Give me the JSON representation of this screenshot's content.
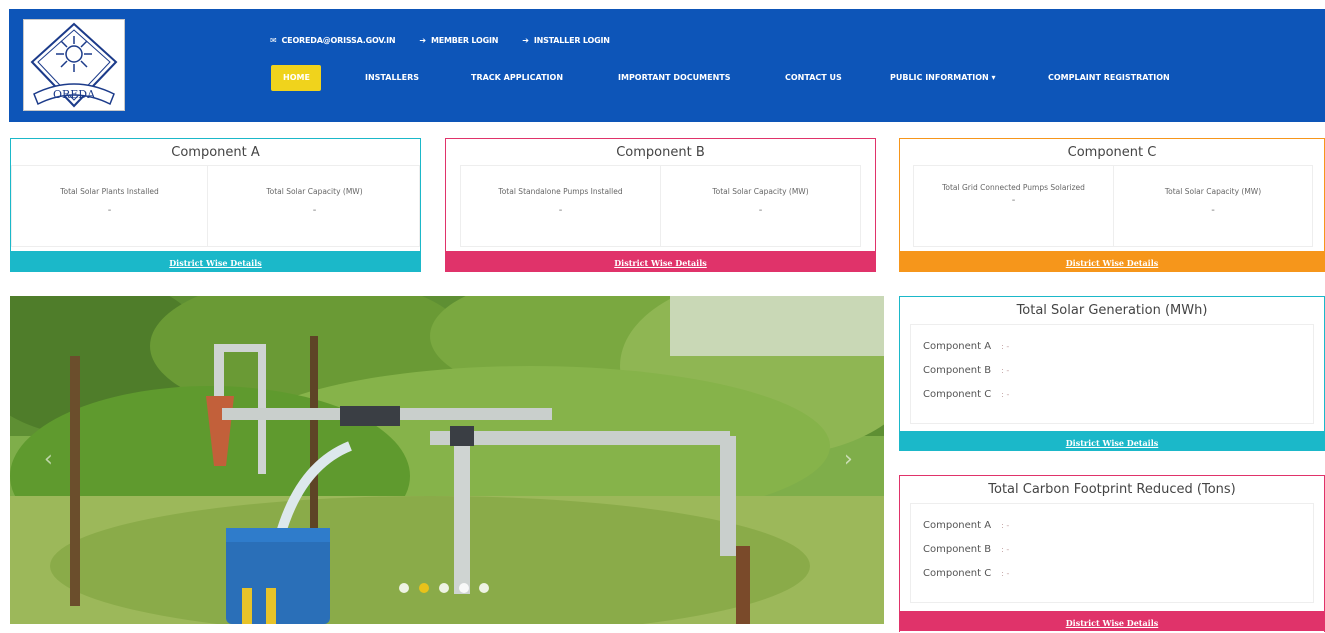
{
  "header": {
    "logo_text": "OREDA",
    "top_links": [
      {
        "label": "CEOREDA@ORISSA.GOV.IN",
        "icon": "envelope-icon"
      },
      {
        "label": "MEMBER LOGIN",
        "icon": "login-icon"
      },
      {
        "label": "INSTALLER LOGIN",
        "icon": "login-icon"
      }
    ],
    "nav": [
      {
        "label": "HOME",
        "active": true
      },
      {
        "label": "INSTALLERS"
      },
      {
        "label": "TRACK APPLICATION"
      },
      {
        "label": "IMPORTANT DOCUMENTS"
      },
      {
        "label": "CONTACT US"
      },
      {
        "label": "PUBLIC INFORMATION ▾"
      },
      {
        "label": "COMPLAINT REGISTRATION"
      }
    ],
    "band_color": "#0d55b8",
    "home_color": "#f0d31c"
  },
  "components": [
    {
      "title": "Component A",
      "cells": [
        {
          "label": "Total Solar Plants Installed",
          "value": "-"
        },
        {
          "label": "Total Solar Capacity (MW)",
          "value": "-"
        }
      ],
      "link": "District Wise Details",
      "color": "#1bb8c9"
    },
    {
      "title": "Component B",
      "cells": [
        {
          "label": "Total Standalone Pumps Installed",
          "value": "-"
        },
        {
          "label": "Total Solar Capacity (MW)",
          "value": "-"
        }
      ],
      "link": "District Wise Details",
      "color": "#e0336a"
    },
    {
      "title": "Component C",
      "cells": [
        {
          "label": "Total Grid Connected Pumps Solarized",
          "value": "-"
        },
        {
          "label": "Total Solar Capacity (MW)",
          "value": "-"
        }
      ],
      "link": "District Wise Details",
      "color": "#f6961b"
    }
  ],
  "generation": {
    "title": "Total Solar Generation (MWh)",
    "rows": [
      {
        "label": "Component A",
        "value": ": -"
      },
      {
        "label": "Component B",
        "value": ": -"
      },
      {
        "label": "Component C",
        "value": ": -"
      }
    ],
    "link": "District Wise Details",
    "color": "#1bb8c9"
  },
  "carbon": {
    "title": "Total Carbon Footprint Reduced (Tons)",
    "rows": [
      {
        "label": "Component A",
        "value": ": -"
      },
      {
        "label": "Component B",
        "value": ": -"
      },
      {
        "label": "Component C",
        "value": ": -"
      }
    ],
    "link": "District Wise Details",
    "color": "#e0336a"
  },
  "slider": {
    "slide_count": 5,
    "active_index": 1
  }
}
